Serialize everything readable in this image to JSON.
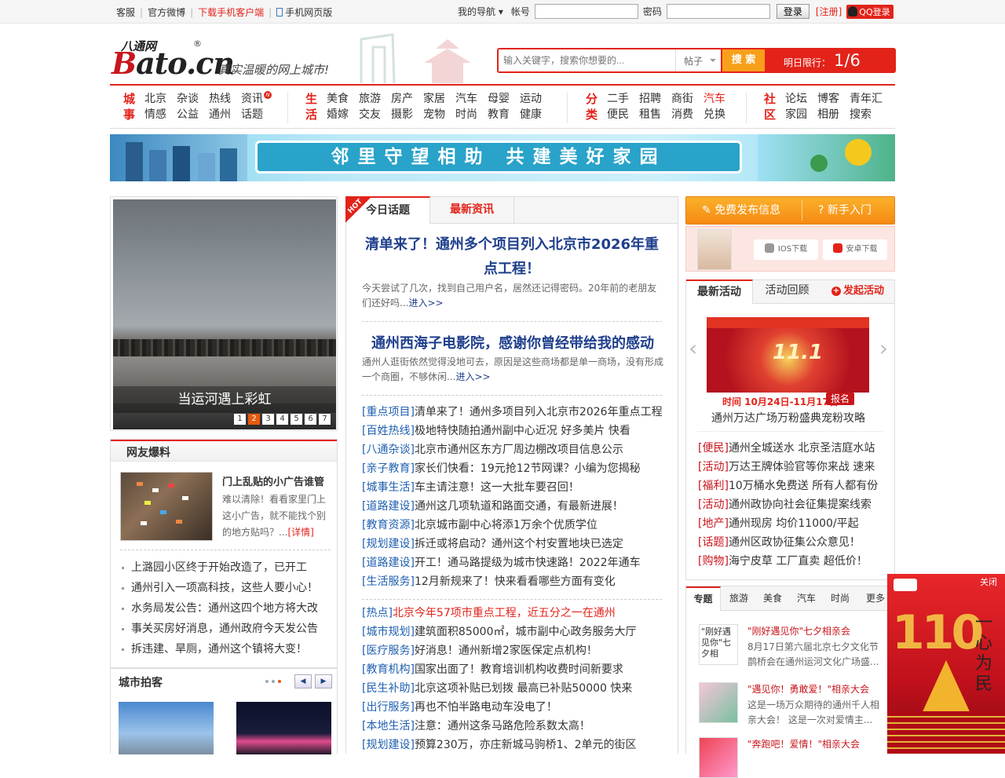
{
  "topbar": {
    "left_links": [
      "客服",
      "官方微博",
      "下载手机客户端",
      "手机网页版"
    ],
    "my_nav": "我的导航",
    "account_label": "帐号",
    "password_label": "密码",
    "login_button": "登录",
    "register": "[注册]",
    "qq_login": "QQ登录"
  },
  "header": {
    "logo_top": "八通网",
    "logo_reg": "®",
    "logo_b": "B",
    "logo_rest": "ato.cn",
    "slogan": "真实温暖的网上城市!",
    "search_placeholder": "输入关键字，搜索你想要的...",
    "search_type": "帖子",
    "search_button": "搜 索",
    "limit_label": "明日限行：",
    "limit_value": "1/6"
  },
  "nav": {
    "city": {
      "cat": [
        "城",
        "事"
      ],
      "links": [
        "北京",
        "情感",
        "杂谈",
        "公益",
        "热线",
        "通州",
        "资讯",
        "话题"
      ]
    },
    "life": {
      "cat": [
        "生",
        "活"
      ],
      "links": [
        "美食",
        "婚嫁",
        "旅游",
        "交友",
        "房产",
        "摄影",
        "家居",
        "宠物",
        "汽车",
        "时尚",
        "母婴",
        "教育",
        "运动",
        "健康"
      ]
    },
    "classified": {
      "cat": [
        "分",
        "类"
      ],
      "links": [
        "二手",
        "便民",
        "招聘",
        "租售",
        "商街",
        "消费",
        "汽车",
        "兑换"
      ]
    },
    "community": {
      "cat": [
        "社",
        "区"
      ],
      "links": [
        "论坛",
        "家园",
        "博客",
        "相册",
        "青年汇",
        "搜索"
      ]
    },
    "badge": "N"
  },
  "banner": {
    "text": "邻里守望相助 共建美好家园"
  },
  "slider": {
    "caption": "当运河遇上彩虹",
    "pages": [
      "1",
      "2",
      "3",
      "4",
      "5",
      "6",
      "7"
    ],
    "active_page": 2
  },
  "netizen": {
    "title": "网友爆料",
    "feature_title": "门上乱贴的小广告谁管",
    "feature_desc": "难以清除！看看家里门上这小广告，就不能找个别的地方贴吗？...",
    "feature_more": "[详情]",
    "list": [
      "上潞园小区终于开始改造了，已开工",
      "通州引入一项高科技，这些人要小心！",
      "水务局发公告：通州这四个地方将大改",
      "事关买房好消息，通州政府今天发公告",
      "拆违建、旱厕，通州这个镇将大变！"
    ]
  },
  "city_photo": {
    "title": "城市拍客"
  },
  "middle": {
    "tabs": [
      "今日话题",
      "最新资讯"
    ],
    "hot": "HOT",
    "headline1": "清单来了！通州多个项目列入北京市2026年重点工程！",
    "summary1": "今天尝试了几次，找到自己用户名，居然还记得密码。20年前的老朋友们还好吗...",
    "more1": "进入>>",
    "headline2": "通州西海子电影院，感谢你曾经带给我的感动",
    "summary2": "通州人逛街依然觉得没地可去，原因是这些商场都是单一商场，没有形成一个商圈，不够休闲...",
    "more2": "进入>>",
    "list1": [
      {
        "tag": "[重点项目]",
        "text": "清单来了！通州多项目列入北京市2026年重点工程"
      },
      {
        "tag": "[百姓热线]",
        "text": "极地特快随拍通州副中心近况 好多美片 快看"
      },
      {
        "tag": "[八通杂谈]",
        "text": "北京市通州区东方厂周边棚改项目信息公示"
      },
      {
        "tag": "[亲子教育]",
        "text": "家长们快看：19元抢12节网课？小编为您揭秘"
      },
      {
        "tag": "[城事生活]",
        "text": "车主请注意！这一大批车要召回！"
      },
      {
        "tag": "[道路建设]",
        "text": "通州这几项轨道和路面交通，有最新进展！"
      },
      {
        "tag": "[教育资源]",
        "text": "北京城市副中心将添1万余个优质学位"
      },
      {
        "tag": "[规划建设]",
        "text": "拆迁或将启动？通州这个村安置地块已选定"
      },
      {
        "tag": "[道路建设]",
        "text": "开工！通马路提级为城市快速路！2022年通车"
      },
      {
        "tag": "[生活服务]",
        "text": "12月新规来了！快来看看哪些方面有变化"
      }
    ],
    "list2": [
      {
        "tag": "[热点]",
        "text": "北京今年57项市重点工程，近五分之一在通州",
        "red": true
      },
      {
        "tag": "[城市规划]",
        "text": "建筑面积85000㎡，城市副中心政务服务大厅"
      },
      {
        "tag": "[医疗服务]",
        "text": "好消息！通州新增2家医保定点机构！"
      },
      {
        "tag": "[教育机构]",
        "text": "国家出面了！教育培训机构收费时间新要求"
      },
      {
        "tag": "[民生补助]",
        "text": "北京这项补贴已划拨 最高已补贴50000 快来"
      },
      {
        "tag": "[出行服务]",
        "text": "再也不怕半路电动车没电了！"
      },
      {
        "tag": "[本地生活]",
        "text": "注意：通州这条马路危险系数太高！"
      },
      {
        "tag": "[规划建设]",
        "text": "预算230万，亦庄新城马驹桥1、2单元的街区"
      }
    ]
  },
  "right": {
    "publish_button": "免费发布信息",
    "newbie_button": "新手入门",
    "ios_download": "IOS下载",
    "android_download": "安卓下载",
    "activity_tabs": [
      "最新活动",
      "活动回顾",
      "发起活动"
    ],
    "poster_text": "11.1",
    "activity_time": "时间 10月24日-11月17日",
    "signup": "报名",
    "activity_name": "通州万达广场万粉盛典宠粉攻略",
    "activity_list": [
      {
        "tag": "[便民]",
        "text": "通州全城送水 北京圣洁庭水站"
      },
      {
        "tag": "[活动]",
        "text": "万达王牌体验官等你来战 速来"
      },
      {
        "tag": "[福利]",
        "text": "10万桶水免费送 所有人都有份"
      },
      {
        "tag": "[活动]",
        "text": "通州政协向社会征集提案线索"
      },
      {
        "tag": "[地产]",
        "text": "通州现房 均价11000/平起"
      },
      {
        "tag": "[话题]",
        "text": "通州区政协征集公众意见！"
      },
      {
        "tag": "[购物]",
        "text": "海宁皮草 工厂直卖 超低价！"
      }
    ],
    "topic_tabs": [
      "专题",
      "旅游",
      "美食",
      "汽车",
      "时尚",
      "更多"
    ],
    "topics": [
      {
        "img_alt": "\"刚好遇见你\"七夕相",
        "title": "\"刚好遇见你\"七夕相亲会",
        "desc": "8月17日第六届北京七夕文化节鹊桥会在通州运河文化广场盛..."
      },
      {
        "title": "\"遇见你！勇敢爱！\"相亲大会",
        "desc": "这是一场万众期待的通州千人相亲大会！ 这是一次对爱情主..."
      },
      {
        "title": "\"奔跑吧！爱情！\"相亲大会",
        "desc": ""
      }
    ]
  },
  "ad": {
    "close": "关闭",
    "slogan": "一心为民"
  }
}
